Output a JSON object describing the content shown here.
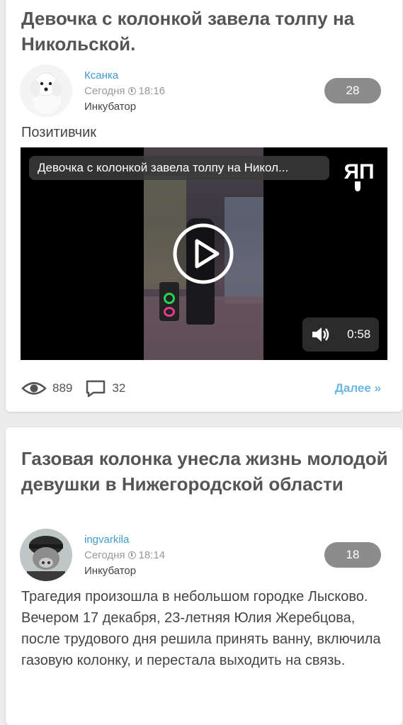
{
  "posts": [
    {
      "title": "Девочка с колонкой завела толпу на Никольской.",
      "author": "Ксанка",
      "time": "Сегодня",
      "clock_time": "18:16",
      "community": "Инкубатор",
      "rating": "28",
      "lead": "Позитивчик",
      "video": {
        "title": "Девочка с колонкой завела толпу на Никол...",
        "logo": "ЯП",
        "duration": "0:58"
      },
      "views": "889",
      "comments": "32",
      "more": "Далее »"
    },
    {
      "title": "Газовая колонка унесла жизнь молодой девушки в Нижегородской области",
      "author": "ingvarkila",
      "time": "Сегодня",
      "clock_time": "18:14",
      "community": "Инкубатор",
      "rating": "18",
      "text": "Трагедия произошла в небольшом городке Лысково. Вечером 17 декабря, 23-летняя Юлия Жеребцова, после трудового дня решила принять ванну, включила газовую колонку, и перестала выходить на связь."
    }
  ],
  "icons": {
    "views": "eye-icon",
    "comments": "comment-icon",
    "time": "clock-icon",
    "sound": "speaker-icon",
    "play": "play-icon"
  },
  "colors": {
    "author_link": "#3d9bd3",
    "rating_badge": "#8c8c8c",
    "more_link": "#6ab6e6"
  }
}
